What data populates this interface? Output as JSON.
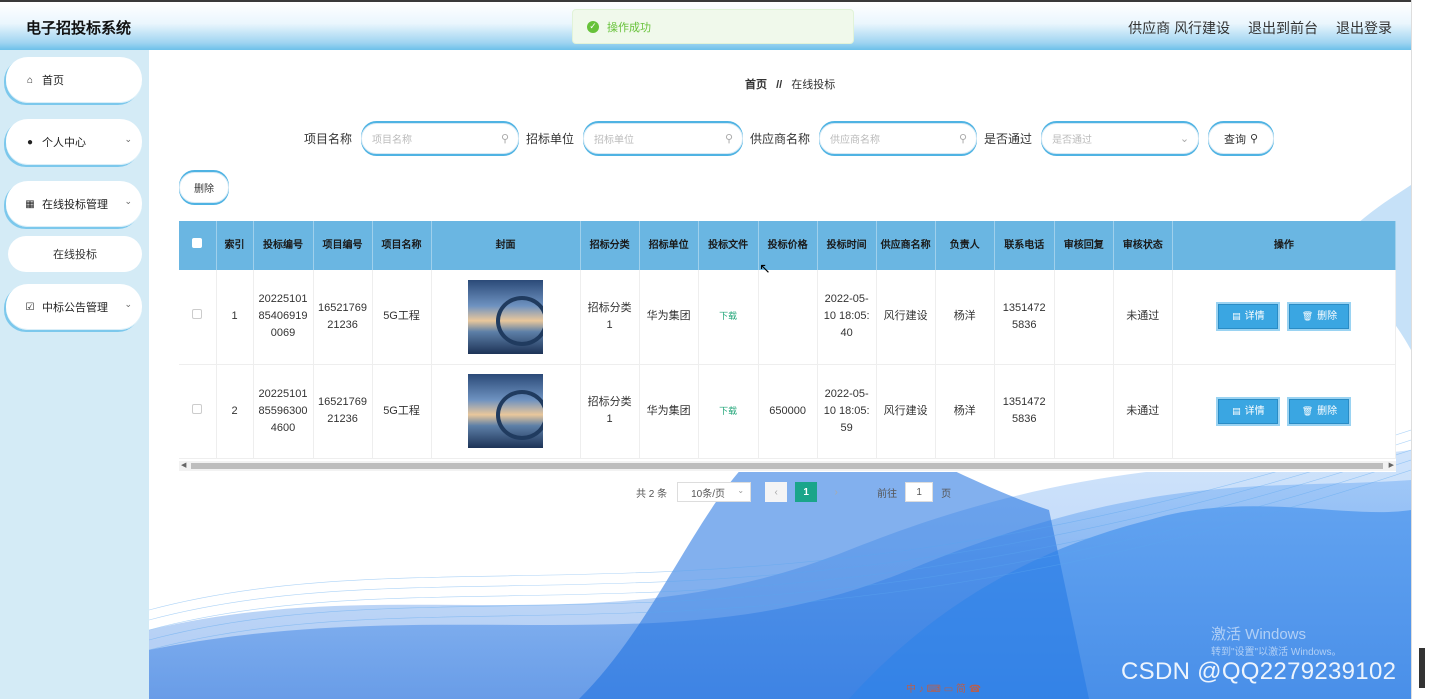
{
  "header": {
    "title": "电子招投标系统",
    "user": "供应商 风行建设",
    "to_front": "退出到前台",
    "logout": "退出登录"
  },
  "toast": {
    "message": "操作成功"
  },
  "sidebar": {
    "items": [
      {
        "label": "首页",
        "icon": "home-icon"
      },
      {
        "label": "个人中心",
        "icon": "user-icon"
      },
      {
        "label": "在线投标管理",
        "icon": "grid-icon"
      },
      {
        "label": "在线投标",
        "icon": ""
      },
      {
        "label": "中标公告管理",
        "icon": "checkbox-icon"
      }
    ]
  },
  "breadcrumb": {
    "home": "首页",
    "sep": "//",
    "current": "在线投标"
  },
  "search": {
    "project_label": "项目名称",
    "project_placeholder": "项目名称",
    "unit_label": "招标单位",
    "unit_placeholder": "招标单位",
    "supplier_label": "供应商名称",
    "supplier_placeholder": "供应商名称",
    "pass_label": "是否通过",
    "pass_placeholder": "是否通过",
    "query_label": "查询"
  },
  "toolbar": {
    "delete_label": "删除"
  },
  "table": {
    "headers": [
      "",
      "索引",
      "投标编号",
      "项目编号",
      "项目名称",
      "封面",
      "招标分类",
      "招标单位",
      "投标文件",
      "投标价格",
      "投标时间",
      "供应商名称",
      "负责人",
      "联系电话",
      "审核回复",
      "审核状态",
      "操作"
    ],
    "rows": [
      {
        "index": "1",
        "bid_no": "20225101854069190069",
        "project_no": "1652176921236",
        "project_name": "5G工程",
        "category": "招标分类1",
        "unit": "华为集团",
        "file": "下载",
        "price": "",
        "time": "2022-05-10 18:05:40",
        "supplier": "风行建设",
        "owner": "杨洋",
        "phone": "13514725836",
        "reply": "",
        "status": "未通过",
        "detail": "详情",
        "delete": "删除"
      },
      {
        "index": "2",
        "bid_no": "20225101855963004600",
        "project_no": "1652176921236",
        "project_name": "5G工程",
        "category": "招标分类1",
        "unit": "华为集团",
        "file": "下载",
        "price": "650000",
        "time": "2022-05-10 18:05:59",
        "supplier": "风行建设",
        "owner": "杨洋",
        "phone": "13514725836",
        "reply": "",
        "status": "未通过",
        "detail": "详情",
        "delete": "删除"
      }
    ]
  },
  "pagination": {
    "total": "共 2 条",
    "page_size": "10条/页",
    "current": "1",
    "goto_label": "前往",
    "goto_value": "1",
    "page_suffix": "页"
  },
  "overlay": {
    "activate_windows": "激活 Windows",
    "activate_hint": "转到\"设置\"以激活 Windows。",
    "csdn": "CSDN @QQ2279239102",
    "taskbar": "中 ♪ ⌨ ▭ 简 ☎"
  }
}
